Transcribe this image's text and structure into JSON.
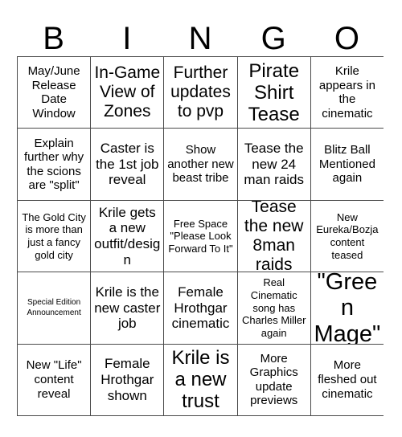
{
  "card": {
    "header_letters": [
      "B",
      "I",
      "N",
      "G",
      "O"
    ],
    "background_color": "#ffffff",
    "border_color": "#4a4a4a",
    "text_color": "#000000",
    "rows": 5,
    "columns": 5
  },
  "cells": [
    {
      "text": "May/June Release Date Window",
      "size": "s"
    },
    {
      "text": "In-Game View of Zones",
      "size": "l"
    },
    {
      "text": "Further updates to pvp",
      "size": "l"
    },
    {
      "text": "Pirate Shirt Tease",
      "size": "xl"
    },
    {
      "text": "Krile appears in the cinematic",
      "size": "s"
    },
    {
      "text": "Explain further why the scions are \"split\"",
      "size": "s"
    },
    {
      "text": "Caster is the 1st job reveal",
      "size": "m"
    },
    {
      "text": "Show another new beast tribe",
      "size": "s"
    },
    {
      "text": "Tease the new 24 man raids",
      "size": "m"
    },
    {
      "text": "Blitz Ball Mentioned again",
      "size": "s"
    },
    {
      "text": "The Gold City is more than just a fancy gold city",
      "size": "xs"
    },
    {
      "text": "Krile gets a new outfit/design",
      "size": "m"
    },
    {
      "text": "Free Space \"Please Look Forward To It\"",
      "size": "xs"
    },
    {
      "text": "Tease the new 8man raids",
      "size": "l"
    },
    {
      "text": "New Eureka/Bozja content teased",
      "size": "xs"
    },
    {
      "text": "Special Edition Announcement",
      "size": "xxs"
    },
    {
      "text": "Krile is the new caster job",
      "size": "m"
    },
    {
      "text": "Female Hrothgar cinematic",
      "size": "m"
    },
    {
      "text": "Real Cinematic song has Charles Miller again",
      "size": "xs"
    },
    {
      "text": "\"Green Mage\"",
      "size": "xxl"
    },
    {
      "text": "New \"Life\" content reveal",
      "size": "s"
    },
    {
      "text": "Female Hrothgar shown",
      "size": "m"
    },
    {
      "text": "Krile is a new trust",
      "size": "xl"
    },
    {
      "text": "More Graphics update previews",
      "size": "s"
    },
    {
      "text": "More fleshed out cinematic",
      "size": "s"
    }
  ]
}
